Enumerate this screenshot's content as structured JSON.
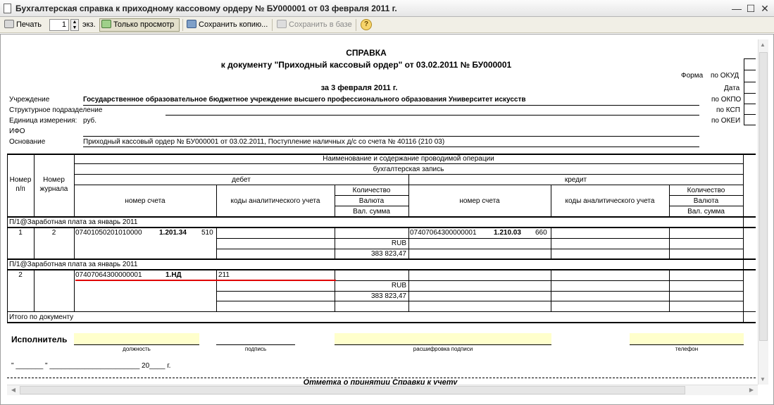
{
  "window": {
    "title": "Бухгалтерская справка к приходному кассовому ордеру № БУ000001 от 03 февраля 2011 г.",
    "minimize": "—",
    "maximize": "☐",
    "close": "✕"
  },
  "toolbar": {
    "print_label": "Печать",
    "copies_value": "1",
    "copies_suffix": "экз.",
    "view_only_label": "Только просмотр",
    "save_copy_label": "Сохранить копию...",
    "save_db_label": "Сохранить в базе",
    "help": "?"
  },
  "document": {
    "heading": "СПРАВКА",
    "subheading": "к документу \"Приходный кассовый ордер\" от 03.02.2011 № БУ000001",
    "date_line": "за 3 февраля 2011 г.",
    "codes": {
      "forma": "Форма",
      "okud": "по ОКУД",
      "data": "Дата",
      "okpo": "по ОКПО",
      "ksp": "по КСП",
      "okei": "по ОКЕИ"
    },
    "fields": {
      "institution_label": "Учреждение",
      "institution_value": "Государственное образовательное бюджетное учреждение высшего профессионального образования  Университет искусств",
      "struct_label": "Структурное подразделение",
      "unit_label": "Единица измерения:",
      "unit_value": "руб.",
      "ifo_label": "ИФО",
      "basis_label": "Основание",
      "basis_value": "Приходный кассовый ордер № БУ000001 от 03.02.2011, Поступление наличных д/с со счета № 40116 (210 03)"
    },
    "table_headers": {
      "num": "Номер п/п",
      "journal": "Номер журнала",
      "operation": "Наименование и содержание проводимой операции",
      "entry": "бухгалтерская запись",
      "debit": "дебет",
      "credit": "кредит",
      "account": "номер счета",
      "analytics": "коды аналитического учета",
      "qty": "Количество",
      "currency": "Валюта",
      "cur_sum": "Вал. сумма"
    },
    "groups": [
      {
        "title": "П/1@Заработная плата за январь 2011",
        "num": "1",
        "journal": "2",
        "debit_account": "07401050201010000",
        "debit_code": "1.201.34",
        "debit_kosgu": "510",
        "debit_analytics": "",
        "debit_currency": "RUB",
        "debit_sum": "383 823,47",
        "credit_account": "07407064300000001",
        "credit_code": "1.210.03",
        "credit_kosgu": "660"
      },
      {
        "title": "П/1@Заработная плата за январь 2011",
        "num": "2",
        "journal": "",
        "debit_account": "07407064300000001",
        "debit_code": "1.НД",
        "debit_kosgu": "",
        "debit_analytics": "211",
        "debit_currency": "RUB",
        "debit_sum": "383 823,47",
        "credit_account": "",
        "credit_code": "",
        "credit_kosgu": ""
      }
    ],
    "total_label": "Итого по документу",
    "signature": {
      "executor": "Исполнитель",
      "position": "должность",
      "sign": "подпись",
      "decode": "расшифровка подписи",
      "phone": "телефон",
      "date_line": "\" _______ \" _______________________ 20____ г."
    },
    "footer_cut": "Отметка о принятии Справки к учету"
  },
  "colors": {
    "highlight": "#ffffcc",
    "red_underline": "#e00000"
  }
}
